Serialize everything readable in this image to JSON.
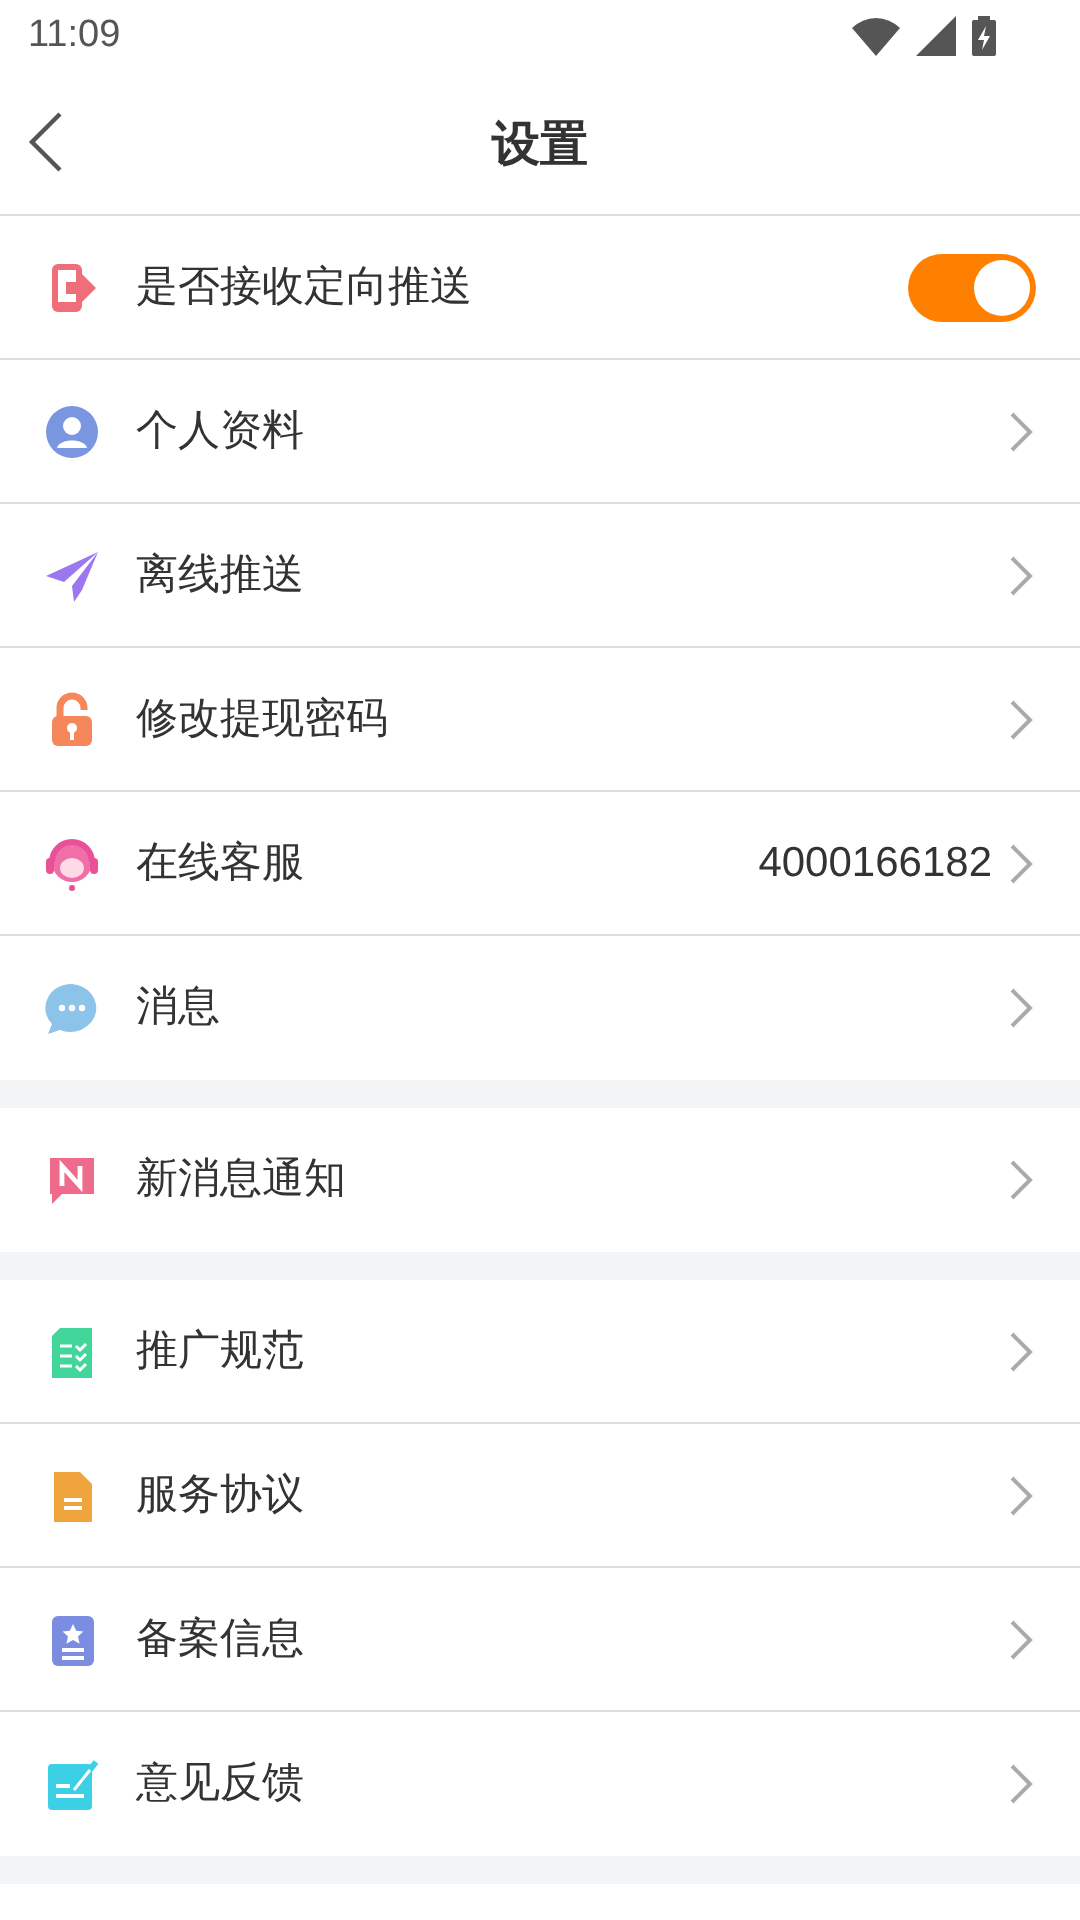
{
  "status_bar": {
    "time": "11:09"
  },
  "header": {
    "title": "设置"
  },
  "sections": [
    {
      "items": [
        {
          "kind": "toggle",
          "label": "是否接收定向推送",
          "on": true
        },
        {
          "kind": "link",
          "label": "个人资料"
        },
        {
          "kind": "link",
          "label": "离线推送"
        },
        {
          "kind": "link",
          "label": "修改提现密码"
        },
        {
          "kind": "link",
          "label": "在线客服",
          "value": "4000166182"
        },
        {
          "kind": "link",
          "label": "消息"
        }
      ]
    },
    {
      "items": [
        {
          "kind": "link",
          "label": "新消息通知"
        }
      ]
    },
    {
      "items": [
        {
          "kind": "link",
          "label": "推广规范"
        },
        {
          "kind": "link",
          "label": "服务协议"
        },
        {
          "kind": "link",
          "label": "备案信息"
        },
        {
          "kind": "link",
          "label": "意见反馈"
        }
      ]
    }
  ]
}
